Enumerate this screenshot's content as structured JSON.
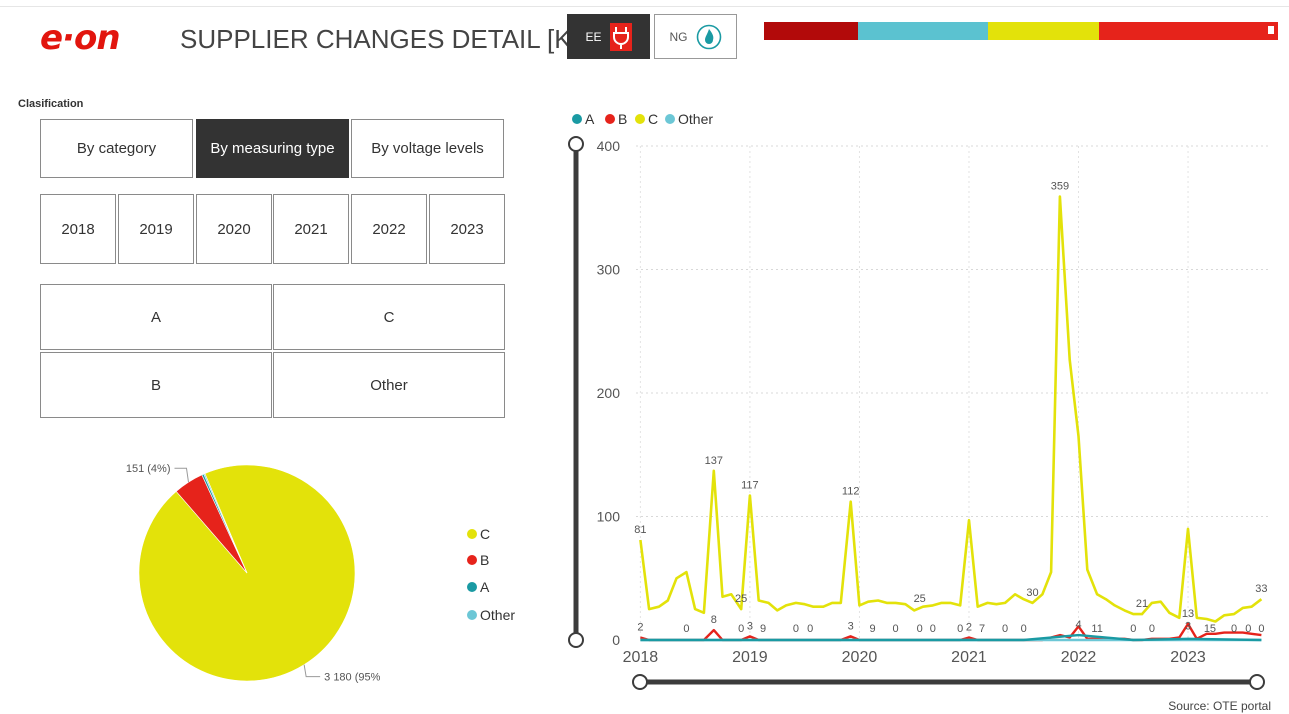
{
  "header": {
    "logo_text": "e·on",
    "title": "SUPPLIER CHANGES DETAIL [K]",
    "energy_ee": "EE",
    "energy_ng": "NG",
    "colorbar": [
      "#b20a0a",
      "#5bc2d0",
      "#e3e20a",
      "#e6231b"
    ]
  },
  "filters": {
    "classification_label": "Clasification",
    "classification_options": [
      "By category",
      "By measuring type",
      "By voltage levels"
    ],
    "classification_selected": "By measuring type",
    "years": [
      "2018",
      "2019",
      "2020",
      "2021",
      "2022",
      "2023"
    ],
    "types": [
      "A",
      "C",
      "B",
      "Other"
    ]
  },
  "pie_legend": [
    {
      "label": "C",
      "color": "#e3e20a"
    },
    {
      "label": "B",
      "color": "#e6231b"
    },
    {
      "label": "A",
      "color": "#1a9aa3"
    },
    {
      "label": "Other",
      "color": "#6cc7d6"
    }
  ],
  "line_legend": [
    {
      "label": "A",
      "color": "#1a9aa3"
    },
    {
      "label": "B",
      "color": "#e6231b"
    },
    {
      "label": "C",
      "color": "#e3e20a"
    },
    {
      "label": "Other",
      "color": "#6cc7d6"
    }
  ],
  "source": "Source: OTE portal",
  "chart_data": [
    {
      "type": "pie",
      "slices": [
        {
          "label": "C",
          "value": 3180,
          "data_label": "3 180 (95%)",
          "color": "#e3e20a"
        },
        {
          "label": "B",
          "value": 151,
          "data_label": "151 (4%)",
          "color": "#e6231b"
        },
        {
          "label": "A",
          "value": 10,
          "color": "#1a9aa3"
        },
        {
          "label": "Other",
          "value": 6,
          "color": "#6cc7d6"
        }
      ]
    },
    {
      "type": "line",
      "x_ticks": [
        "2018",
        "2019",
        "2020",
        "2021",
        "2022",
        "2023"
      ],
      "x_range": [
        2017.96,
        2023.73
      ],
      "ylim": [
        0,
        400
      ],
      "y_ticks": [
        0,
        100,
        200,
        300,
        400
      ],
      "grid": true,
      "legend_position": "top-left",
      "series": [
        {
          "name": "C",
          "color": "#e3e20a",
          "x": [
            2018.0,
            2018.08,
            2018.17,
            2018.25,
            2018.33,
            2018.42,
            2018.5,
            2018.58,
            2018.67,
            2018.75,
            2018.83,
            2018.92,
            2019.0,
            2019.08,
            2019.17,
            2019.25,
            2019.33,
            2019.42,
            2019.5,
            2019.58,
            2019.67,
            2019.75,
            2019.83,
            2019.92,
            2020.0,
            2020.08,
            2020.17,
            2020.25,
            2020.33,
            2020.42,
            2020.5,
            2020.58,
            2020.67,
            2020.75,
            2020.83,
            2020.92,
            2021.0,
            2021.08,
            2021.17,
            2021.25,
            2021.33,
            2021.42,
            2021.5,
            2021.58,
            2021.67,
            2021.75,
            2021.83,
            2021.92,
            2022.0,
            2022.08,
            2022.17,
            2022.25,
            2022.33,
            2022.42,
            2022.5,
            2022.58,
            2022.67,
            2022.75,
            2022.83,
            2022.92,
            2023.0,
            2023.08,
            2023.17,
            2023.25,
            2023.33,
            2023.42,
            2023.5,
            2023.58,
            2023.67
          ],
          "values": [
            81,
            25,
            27,
            32,
            50,
            55,
            25,
            22,
            137,
            35,
            37,
            25,
            117,
            32,
            30,
            24,
            28,
            30,
            29,
            27,
            27,
            30,
            30,
            112,
            28,
            31,
            32,
            30,
            30,
            29,
            24,
            27,
            28,
            30,
            30,
            28,
            97,
            27,
            30,
            29,
            30,
            37,
            33,
            30,
            37,
            55,
            359,
            227,
            165,
            57,
            37,
            33,
            28,
            24,
            21,
            21,
            30,
            31,
            22,
            18,
            90,
            18,
            17,
            15,
            20,
            21,
            26,
            27,
            33
          ]
        },
        {
          "name": "B",
          "color": "#e6231b",
          "x": [
            2018.0,
            2018.08,
            2018.17,
            2018.25,
            2018.33,
            2018.42,
            2018.5,
            2018.58,
            2018.67,
            2018.75,
            2018.83,
            2018.92,
            2019.0,
            2019.08,
            2019.17,
            2019.25,
            2019.33,
            2019.42,
            2019.5,
            2019.58,
            2019.67,
            2019.75,
            2019.83,
            2019.92,
            2020.0,
            2020.08,
            2020.17,
            2020.25,
            2020.33,
            2020.42,
            2020.5,
            2020.58,
            2020.67,
            2020.75,
            2020.83,
            2020.92,
            2021.0,
            2021.08,
            2021.17,
            2021.25,
            2021.33,
            2021.42,
            2021.5,
            2021.58,
            2021.67,
            2021.75,
            2021.83,
            2021.92,
            2022.0,
            2022.08,
            2022.17,
            2022.25,
            2022.33,
            2022.42,
            2022.5,
            2022.58,
            2022.67,
            2022.75,
            2022.83,
            2022.92,
            2023.0,
            2023.08,
            2023.17,
            2023.25,
            2023.33,
            2023.42,
            2023.5,
            2023.58,
            2023.67
          ],
          "values": [
            2,
            0,
            0,
            0,
            0,
            0,
            0,
            0,
            8,
            0,
            0,
            0,
            3,
            0,
            0,
            0,
            0,
            0,
            0,
            0,
            0,
            0,
            0,
            3,
            0,
            0,
            0,
            0,
            0,
            0,
            0,
            0,
            0,
            0,
            0,
            0,
            2,
            0,
            0,
            0,
            0,
            0,
            0,
            0,
            0,
            2,
            4,
            2,
            11,
            1,
            1,
            1,
            1,
            1,
            0,
            0,
            1,
            1,
            1,
            2,
            13,
            1,
            5,
            5,
            6,
            6,
            6,
            5,
            4
          ]
        },
        {
          "name": "A",
          "color": "#1a9aa3",
          "x": [
            2018.0,
            2018.5,
            2019.0,
            2019.5,
            2020.0,
            2020.5,
            2021.0,
            2021.5,
            2022.0,
            2022.5,
            2023.0,
            2023.67
          ],
          "values": [
            0,
            0,
            0,
            0,
            0,
            0,
            0,
            0,
            4,
            0,
            1,
            0
          ]
        },
        {
          "name": "Other",
          "color": "#6cc7d6",
          "x": [
            2018.0,
            2023.67
          ],
          "values": [
            0,
            0
          ]
        }
      ],
      "data_labels": [
        {
          "x": 2018.0,
          "y": 81,
          "text": "81"
        },
        {
          "x": 2018.67,
          "y": 137,
          "text": "137"
        },
        {
          "x": 2019.0,
          "y": 117,
          "text": "117"
        },
        {
          "x": 2019.92,
          "y": 112,
          "text": "112"
        },
        {
          "x": 2021.83,
          "y": 359,
          "text": "359"
        },
        {
          "x": 2023.67,
          "y": 33,
          "text": "33"
        },
        {
          "x": 2018.92,
          "y": 25,
          "text": "25"
        },
        {
          "x": 2020.55,
          "y": 25,
          "text": "25"
        },
        {
          "x": 2021.58,
          "y": 30,
          "text": "30"
        },
        {
          "x": 2022.58,
          "y": 21,
          "text": "21"
        },
        {
          "x": 2023.0,
          "y": 13,
          "text": "13"
        },
        {
          "x": 2018.0,
          "y": 2,
          "text": "2"
        },
        {
          "x": 2018.67,
          "y": 8,
          "text": "8"
        },
        {
          "x": 2019.0,
          "y": 3,
          "text": "3"
        },
        {
          "x": 2019.92,
          "y": 3,
          "text": "3"
        },
        {
          "x": 2021.0,
          "y": 2,
          "text": "2"
        },
        {
          "x": 2022.0,
          "y": 4,
          "text": "4"
        },
        {
          "x": 2023.0,
          "y": 3,
          "text": "3"
        },
        {
          "x": 2018.42,
          "y": 0,
          "text": "0"
        },
        {
          "x": 2018.92,
          "y": 0,
          "text": "0"
        },
        {
          "x": 2019.12,
          "y": 0,
          "text": "9"
        },
        {
          "x": 2019.42,
          "y": 0,
          "text": "0"
        },
        {
          "x": 2019.55,
          "y": 0,
          "text": "0"
        },
        {
          "x": 2020.12,
          "y": 0,
          "text": "9"
        },
        {
          "x": 2020.33,
          "y": 0,
          "text": "0"
        },
        {
          "x": 2020.55,
          "y": 0,
          "text": "0"
        },
        {
          "x": 2020.67,
          "y": 0,
          "text": "0"
        },
        {
          "x": 2020.92,
          "y": 0,
          "text": "0"
        },
        {
          "x": 2021.12,
          "y": 0,
          "text": "7"
        },
        {
          "x": 2021.33,
          "y": 0,
          "text": "0"
        },
        {
          "x": 2021.5,
          "y": 0,
          "text": "0"
        },
        {
          "x": 2022.17,
          "y": 0,
          "text": "11"
        },
        {
          "x": 2022.5,
          "y": 0,
          "text": "0"
        },
        {
          "x": 2022.67,
          "y": 0,
          "text": "0"
        },
        {
          "x": 2023.2,
          "y": 0,
          "text": "15"
        },
        {
          "x": 2023.42,
          "y": 0,
          "text": "0"
        },
        {
          "x": 2023.55,
          "y": 0,
          "text": "0"
        },
        {
          "x": 2023.67,
          "y": 0,
          "text": "0"
        }
      ]
    }
  ]
}
